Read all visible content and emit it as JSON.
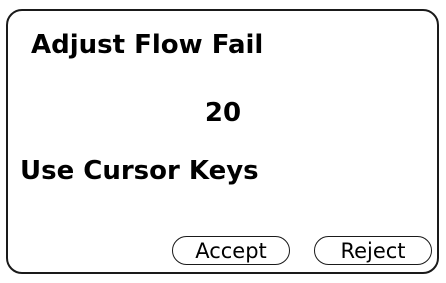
{
  "screen": {
    "title": "Adjust Flow Fail",
    "value": "20",
    "hint": "Use Cursor Keys"
  },
  "buttons": {
    "accept_label": "Accept",
    "reject_label": "Reject"
  },
  "colors": {
    "background": "#ffffff",
    "border": "#1a1a1a",
    "text": "#000000"
  }
}
